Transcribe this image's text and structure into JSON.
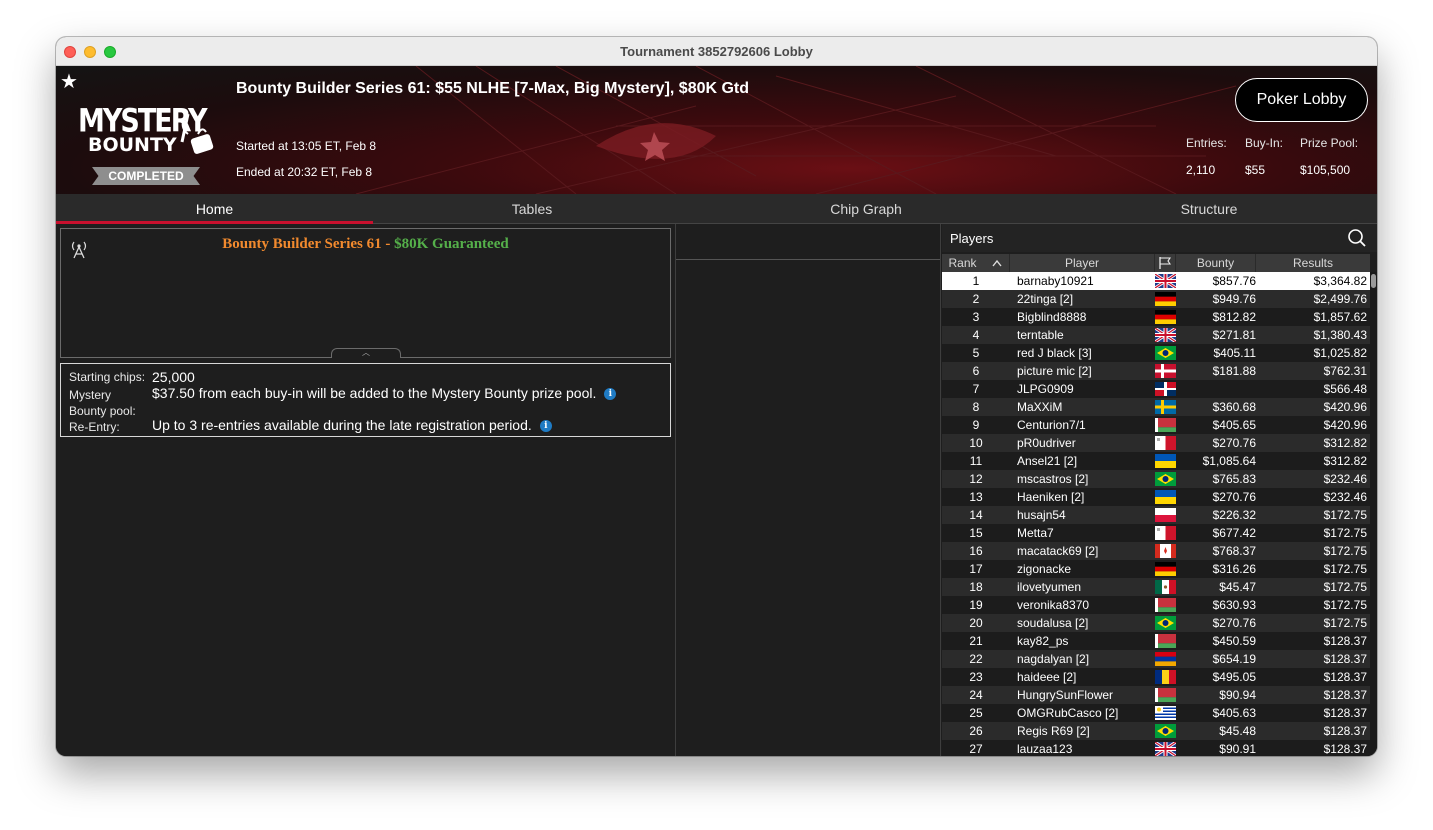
{
  "window": {
    "title": "Tournament 3852792606 Lobby"
  },
  "header": {
    "logo_line1": "MYSTERY",
    "logo_line2": "BOUNTY",
    "status_badge": "COMPLETED",
    "tournament_name": "Bounty Builder Series 61: $55 NLHE [7-Max, Big Mystery], $80K Gtd",
    "started": "Started at 13:05 ET, Feb 8",
    "ended": "Ended at 20:32 ET, Feb 8",
    "lobby_button": "Poker Lobby",
    "stats": {
      "entries_label": "Entries:",
      "entries_value": "2,110",
      "buyin_label": "Buy-In:",
      "buyin_value": "$55",
      "prize_label": "Prize Pool:",
      "prize_value": "$105,500"
    }
  },
  "tabs": [
    {
      "label": "Home",
      "active": true
    },
    {
      "label": "Tables",
      "active": false
    },
    {
      "label": "Chip Graph",
      "active": false
    },
    {
      "label": "Structure",
      "active": false
    }
  ],
  "announcement": {
    "part1": "Bounty Builder Series 61",
    "separator": " - ",
    "part2": "$80K Guaranteed"
  },
  "details": {
    "starting_chips_label": "Starting chips:",
    "starting_chips_value": "25,000",
    "mystery_label_1": "Mystery",
    "mystery_label_2": "Bounty pool:",
    "mystery_value": "$37.50 from each buy-in will be added to the Mystery Bounty prize pool.",
    "reentry_label": "Re-Entry:",
    "reentry_value": "Up to 3 re-entries available during the late registration period."
  },
  "players": {
    "title": "Players",
    "columns": {
      "rank": "Rank",
      "player": "Player",
      "bounty": "Bounty",
      "results": "Results"
    },
    "rows": [
      {
        "rank": "1",
        "player": "barnaby10921",
        "flag": "gb",
        "bounty": "$857.76",
        "results": "$3,364.82"
      },
      {
        "rank": "2",
        "player": "22tinga [2]",
        "flag": "de",
        "bounty": "$949.76",
        "results": "$2,499.76"
      },
      {
        "rank": "3",
        "player": "Bigblind8888",
        "flag": "de",
        "bounty": "$812.82",
        "results": "$1,857.62"
      },
      {
        "rank": "4",
        "player": "terntable",
        "flag": "gb",
        "bounty": "$271.81",
        "results": "$1,380.43"
      },
      {
        "rank": "5",
        "player": "red J black [3]",
        "flag": "br",
        "bounty": "$405.11",
        "results": "$1,025.82"
      },
      {
        "rank": "6",
        "player": "picture mic [2]",
        "flag": "dk",
        "bounty": "$181.88",
        "results": "$762.31"
      },
      {
        "rank": "7",
        "player": "JLPG0909",
        "flag": "do",
        "bounty": "",
        "results": "$566.48"
      },
      {
        "rank": "8",
        "player": "MaXXiM",
        "flag": "se",
        "bounty": "$360.68",
        "results": "$420.96"
      },
      {
        "rank": "9",
        "player": "Centurion7/1",
        "flag": "by",
        "bounty": "$405.65",
        "results": "$420.96"
      },
      {
        "rank": "10",
        "player": "pR0udriver",
        "flag": "mt",
        "bounty": "$270.76",
        "results": "$312.82"
      },
      {
        "rank": "11",
        "player": "Ansel21 [2]",
        "flag": "ua",
        "bounty": "$1,085.64",
        "results": "$312.82"
      },
      {
        "rank": "12",
        "player": "mscastros [2]",
        "flag": "br",
        "bounty": "$765.83",
        "results": "$232.46"
      },
      {
        "rank": "13",
        "player": "Haeniken [2]",
        "flag": "ua",
        "bounty": "$270.76",
        "results": "$232.46"
      },
      {
        "rank": "14",
        "player": "husajn54",
        "flag": "pl",
        "bounty": "$226.32",
        "results": "$172.75"
      },
      {
        "rank": "15",
        "player": "Metta7",
        "flag": "mt",
        "bounty": "$677.42",
        "results": "$172.75"
      },
      {
        "rank": "16",
        "player": "macatack69 [2]",
        "flag": "ca",
        "bounty": "$768.37",
        "results": "$172.75"
      },
      {
        "rank": "17",
        "player": "zigonacke",
        "flag": "de",
        "bounty": "$316.26",
        "results": "$172.75"
      },
      {
        "rank": "18",
        "player": "ilovetyumen",
        "flag": "mx",
        "bounty": "$45.47",
        "results": "$172.75"
      },
      {
        "rank": "19",
        "player": "veronika8370",
        "flag": "by",
        "bounty": "$630.93",
        "results": "$172.75"
      },
      {
        "rank": "20",
        "player": "soudalusa [2]",
        "flag": "br",
        "bounty": "$270.76",
        "results": "$172.75"
      },
      {
        "rank": "21",
        "player": "kay82_ps",
        "flag": "by",
        "bounty": "$450.59",
        "results": "$128.37"
      },
      {
        "rank": "22",
        "player": "nagdalyan [2]",
        "flag": "am",
        "bounty": "$654.19",
        "results": "$128.37"
      },
      {
        "rank": "23",
        "player": "haideee [2]",
        "flag": "ro",
        "bounty": "$495.05",
        "results": "$128.37"
      },
      {
        "rank": "24",
        "player": "HungrySunFlower",
        "flag": "by",
        "bounty": "$90.94",
        "results": "$128.37"
      },
      {
        "rank": "25",
        "player": "OMGRubCasco [2]",
        "flag": "uy",
        "bounty": "$405.63",
        "results": "$128.37"
      },
      {
        "rank": "26",
        "player": "Regis R69 [2]",
        "flag": "br",
        "bounty": "$45.48",
        "results": "$128.37"
      },
      {
        "rank": "27",
        "player": "lauzaa123",
        "flag": "gb",
        "bounty": "$90.91",
        "results": "$128.37"
      }
    ]
  },
  "colors": {
    "accent_red": "#c8102e",
    "announce_orange": "#f28a2e",
    "announce_green": "#55b04a",
    "info_blue": "#1f7bc4"
  }
}
